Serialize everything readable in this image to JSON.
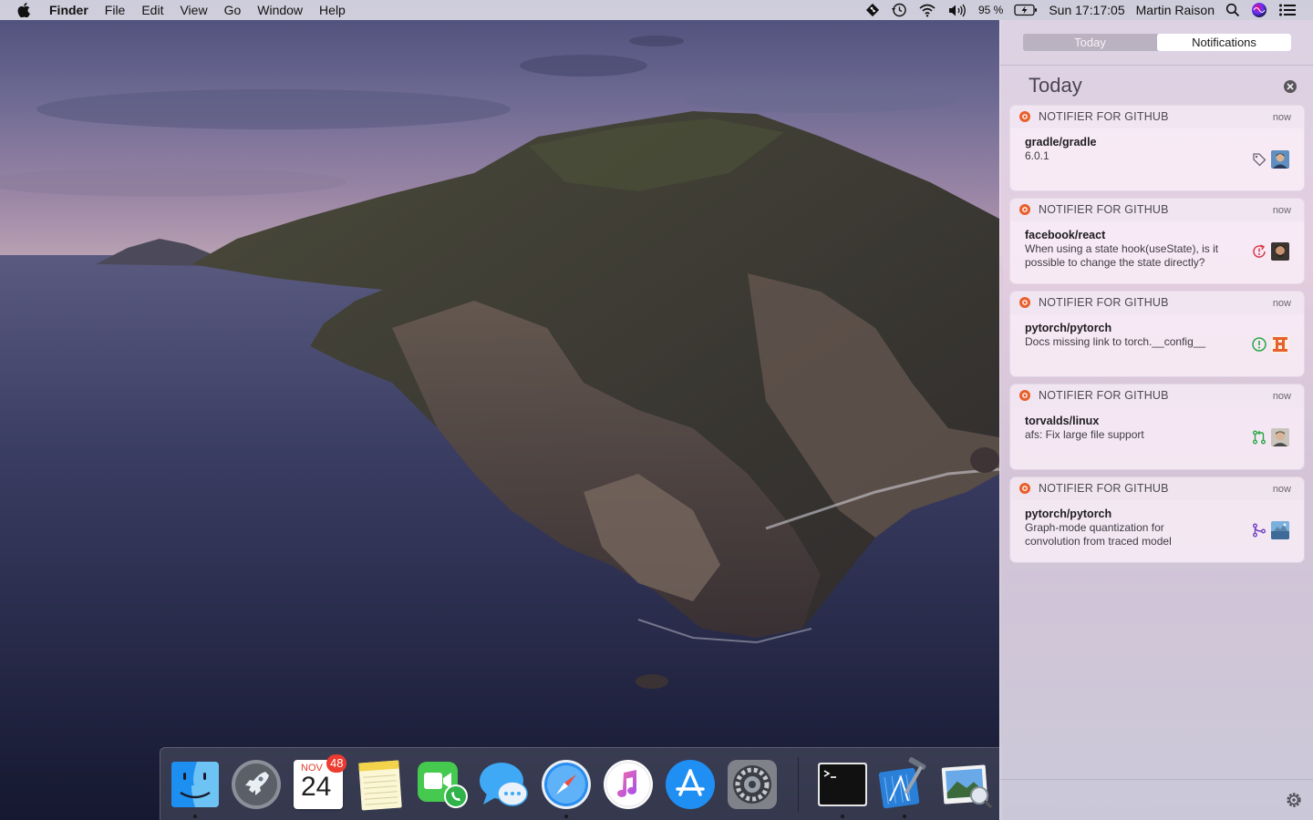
{
  "menubar": {
    "apple_icon": "apple-logo-icon",
    "app_name": "Finder",
    "menus": [
      "File",
      "Edit",
      "View",
      "Go",
      "Window",
      "Help"
    ],
    "status_icons": [
      "git-diamond-icon",
      "time-machine-icon",
      "wifi-icon",
      "volume-icon"
    ],
    "battery_percent": "95 %",
    "battery_icon": "battery-charging-icon",
    "clock": "Sun 17:17:05",
    "user_name": "Martin Raison",
    "search_icon": "spotlight-search-icon",
    "siri_icon": "siri-icon",
    "notification_center_icon": "notification-center-icon"
  },
  "notification_center": {
    "tabs": [
      "Today",
      "Notifications"
    ],
    "active_tab": "Notifications",
    "section_title": "Today",
    "notifications": [
      {
        "app": "NOTIFIER FOR GITHUB",
        "time": "now",
        "title": "gradle/gradle",
        "text": "6.0.1",
        "type_icon": "tag-icon"
      },
      {
        "app": "NOTIFIER FOR GITHUB",
        "time": "now",
        "title": "facebook/react",
        "text": "When using a state hook(useState), is it possible to change the state directly?",
        "type_icon": "issue-reopened-icon"
      },
      {
        "app": "NOTIFIER FOR GITHUB",
        "time": "now",
        "title": "pytorch/pytorch",
        "text": "Docs missing link to torch.__config__",
        "type_icon": "issue-opened-icon"
      },
      {
        "app": "NOTIFIER FOR GITHUB",
        "time": "now",
        "title": "torvalds/linux",
        "text": "afs: Fix large file support",
        "type_icon": "pull-request-icon"
      },
      {
        "app": "NOTIFIER FOR GITHUB",
        "time": "now",
        "title": "pytorch/pytorch",
        "text": "Graph-mode quantization for convolution from traced model",
        "type_icon": "merged-icon"
      }
    ]
  },
  "dock": {
    "calendar_month": "NOV",
    "calendar_day": "24",
    "calendar_badge": "48",
    "apps": [
      "Finder",
      "Launchpad",
      "Calendar",
      "Notes",
      "FaceTime",
      "Messages",
      "Safari",
      "iTunes",
      "App Store",
      "System Preferences",
      "Terminal",
      "Xcode",
      "Preview"
    ]
  },
  "colors": {
    "github_notifier": "#e8602c",
    "issue_red": "#d73a49",
    "issue_green": "#28a745",
    "merged_purple": "#6f42c1"
  }
}
